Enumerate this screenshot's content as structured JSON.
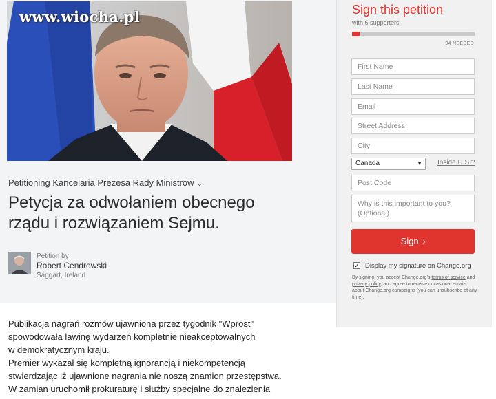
{
  "watermark": "www.wiocha.pl",
  "petition": {
    "petitioning": "Petitioning Kancelaria Prezesa Rady Ministrow",
    "title": "Petycja za odwołaniem obecnego rządu i rozwiązaniem Sejmu.",
    "petition_by": "Petition by",
    "author_name": "Robert Cendrowski",
    "author_location": "Saggart, Ireland",
    "body": [
      "Publikacja nagrań rozmów ujawniona przez tygodnik \"Wprost\"",
      "spowodowała lawinę wydarzeń kompletnie nieakceptowalnych",
      "w demokratycznym kraju.",
      "Premier wykazał się kompletną ignorancją i niekompetencją",
      "stwierdzając iż ujawnione nagrania nie noszą znamion przestępstwa.",
      "W zamian uruchomił prokuraturę i służby specjalne do znalezienia"
    ]
  },
  "sign": {
    "title": "Sign this petition",
    "supporters": "with 6 supporters",
    "progress_fraction": 0.06,
    "needed": "94 NEEDED",
    "first_name_placeholder": "First Name",
    "last_name_placeholder": "Last Name",
    "email_placeholder": "Email",
    "street_placeholder": "Street Address",
    "city_placeholder": "City",
    "country_value": "Canada",
    "inside_us": "Inside U.S.?",
    "postcode_placeholder": "Post Code",
    "reason_placeholder_line1": "Why is this important to you?",
    "reason_placeholder_line2": "(Optional)",
    "button_label": "Sign",
    "display_signature": "Display my signature on Change.org",
    "display_checked": true,
    "legal_1": "By signing, you accept Change.org's ",
    "legal_terms": "terms of service",
    "legal_2": " and ",
    "legal_privacy": "privacy policy",
    "legal_3": ", and agree to receive occasional emails about Change.org campaigns (you can unsubscribe at any time).",
    "accent_color": "#e0342f"
  }
}
